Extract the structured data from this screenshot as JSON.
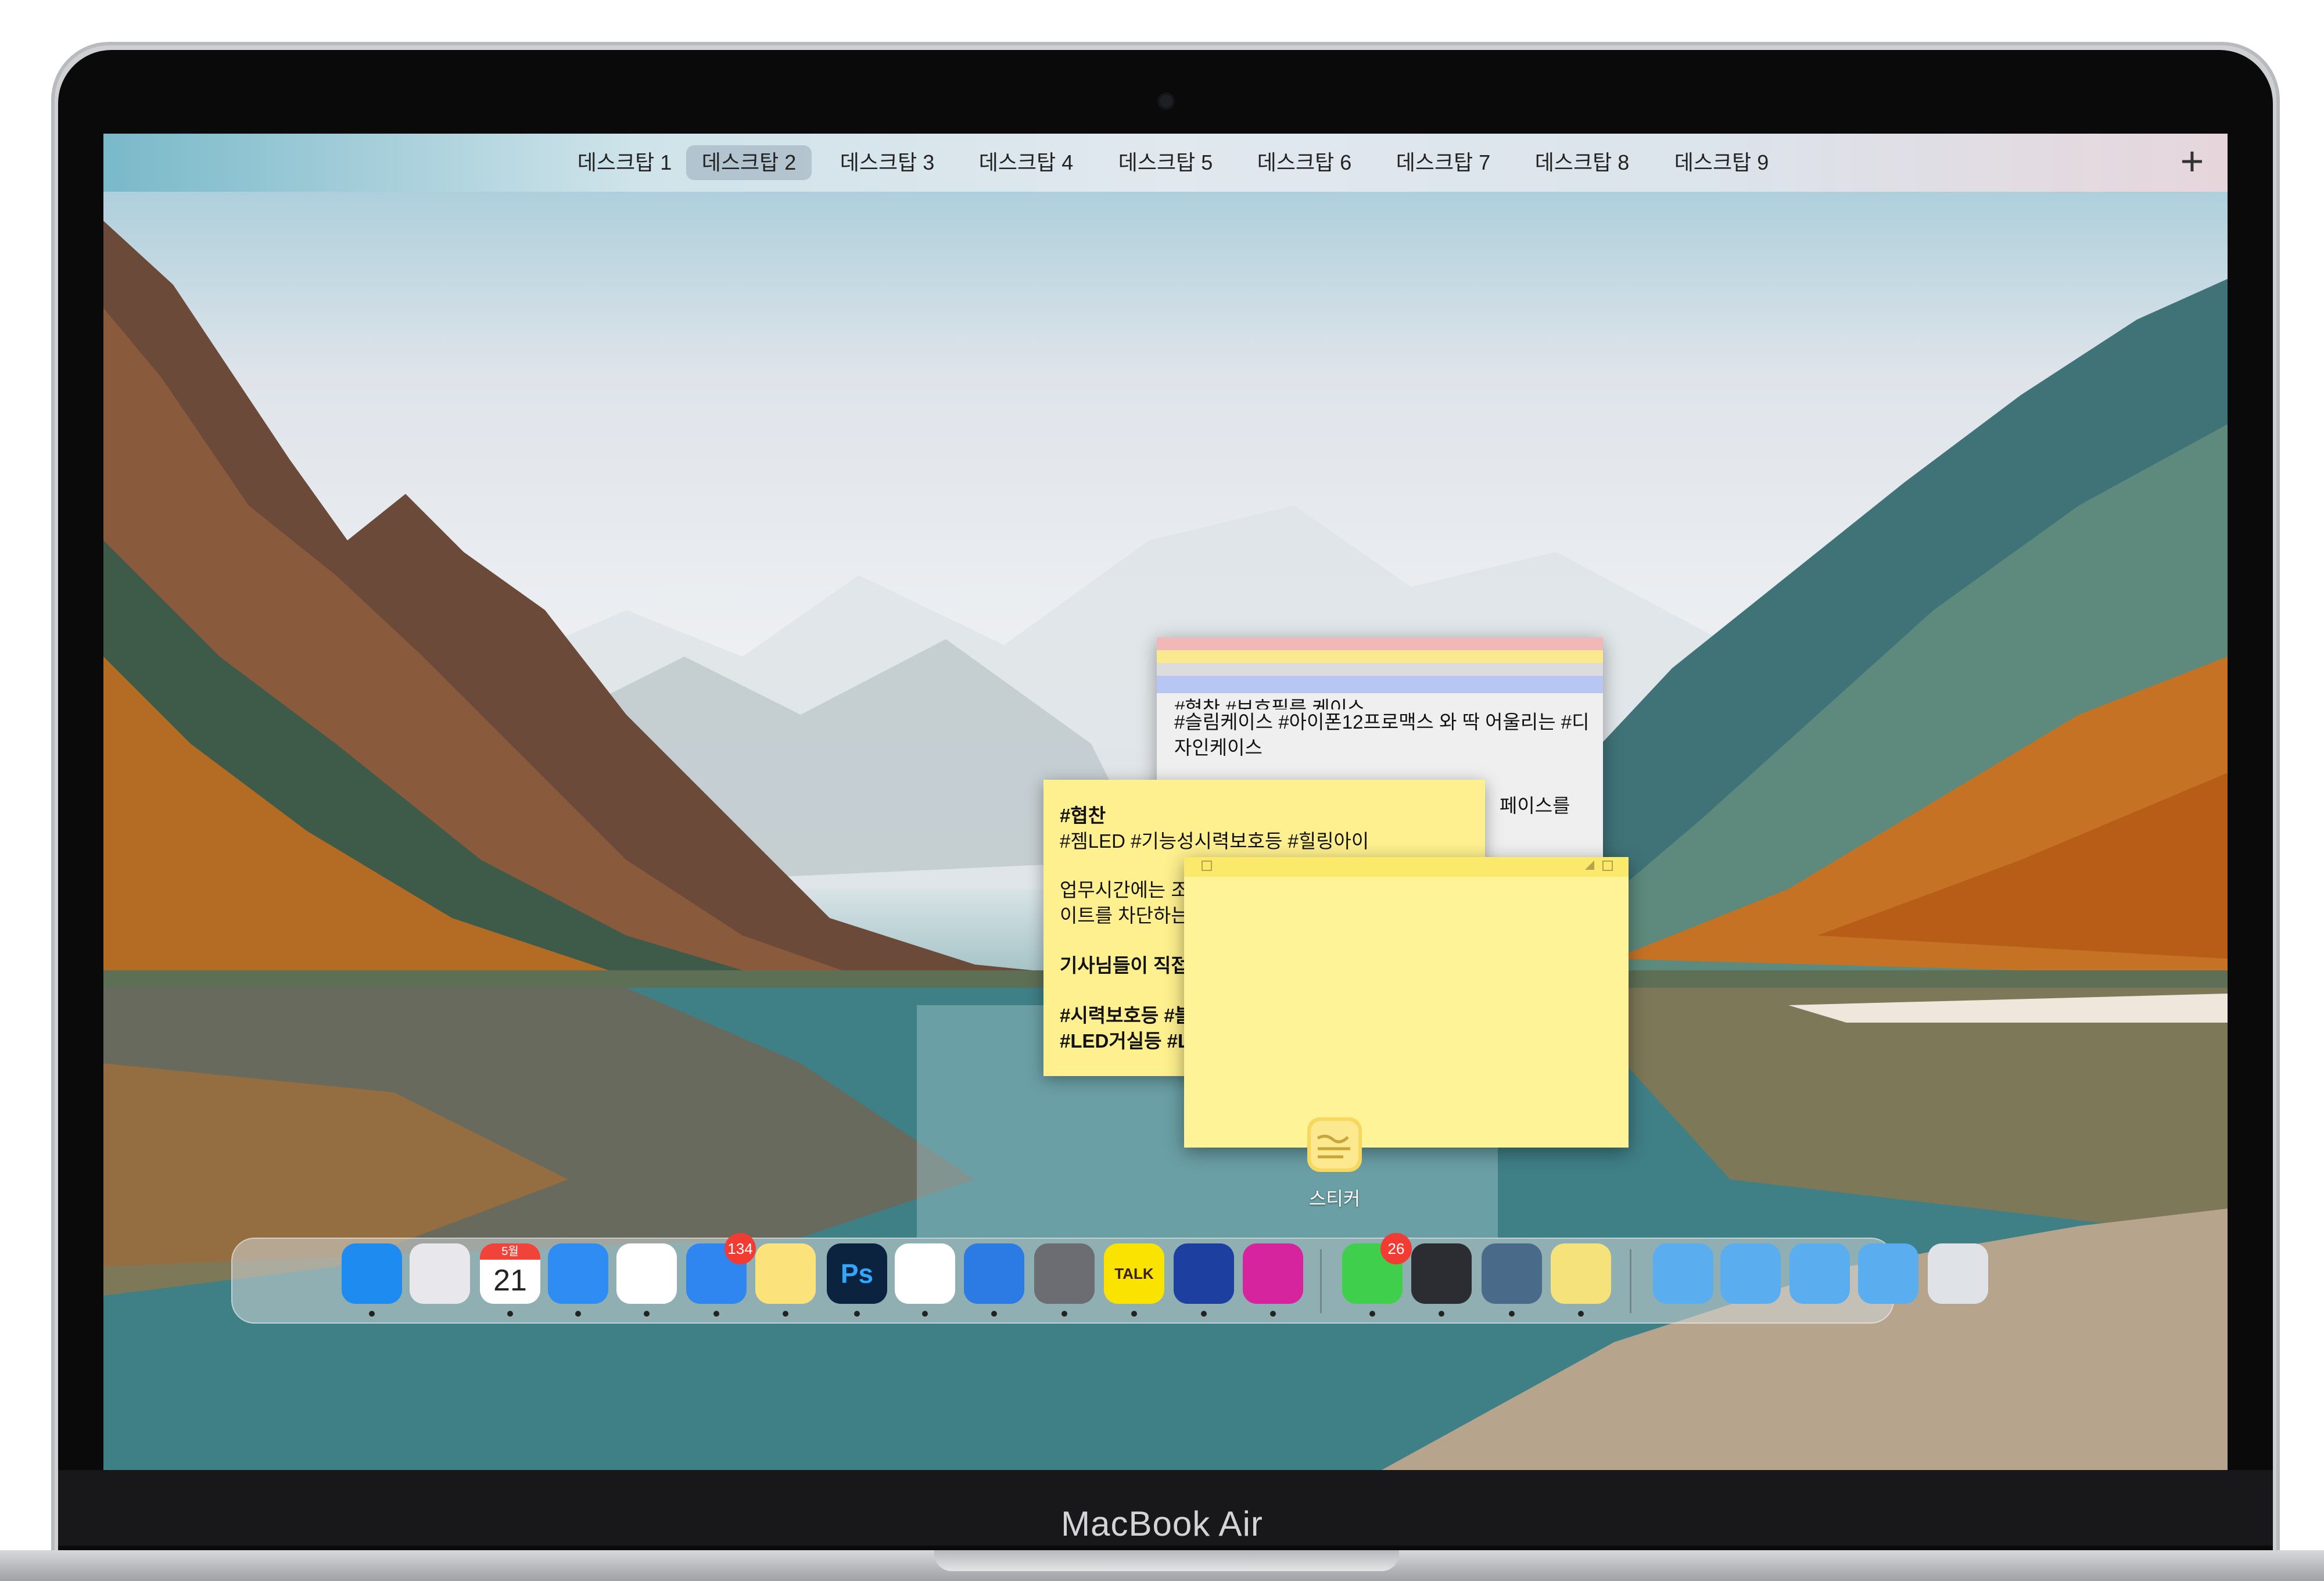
{
  "device": {
    "brand": "MacBook Air"
  },
  "spaces_bar": {
    "tabs": [
      "데스크탑 1",
      "데스크탑 2",
      "데스크탑 3",
      "데스크탑 4",
      "데스크탑 5",
      "데스크탑 6",
      "데스크탑 7",
      "데스크탑 8",
      "데스크탑 9"
    ],
    "active_index": 1,
    "add_label": "+"
  },
  "stickies": {
    "stack_note": {
      "line1": "#협찬 #보호필름 케이스",
      "line2": "#슬림케이스 #아이폰12프로맥스 와 딱 어울리는 #디",
      "line3": "자인케이스",
      "line4": "페이스를"
    },
    "middle_note": {
      "title": "#협찬",
      "tags": "#젬LED #기능성시력보호등 #힐링아이",
      "p1": "업무시간에는 조",
      "p2": "이트를 차단하는",
      "p3": "기사님들이 직접",
      "p4": "#시력보호등 #블",
      "p5": "#LED거실등 #L"
    },
    "app_label": "스티커"
  },
  "dock": {
    "items": [
      {
        "name": "finder-icon",
        "color": "#1e8bf0"
      },
      {
        "name": "launchpad-icon",
        "color": "#e8e8ec"
      },
      {
        "name": "calendar-icon",
        "color": "#ffffff",
        "month": "5월",
        "day": "21"
      },
      {
        "name": "safari-icon",
        "color": "#2f8cf2"
      },
      {
        "name": "photos-icon",
        "color": "#ffffff"
      },
      {
        "name": "mail-icon",
        "color": "#2f86f0",
        "badge": "134"
      },
      {
        "name": "notes-icon",
        "color": "#fbe27a"
      },
      {
        "name": "photoshop-icon",
        "color": "#0c2340",
        "text": "Ps"
      },
      {
        "name": "chrome-icon",
        "color": "#ffffff"
      },
      {
        "name": "keynote-icon",
        "color": "#2c7be5"
      },
      {
        "name": "system-preferences-icon",
        "color": "#6b6d72"
      },
      {
        "name": "kakaotalk-icon",
        "color": "#fbe300",
        "text": "TALK"
      },
      {
        "name": "tasks-icon",
        "color": "#1d3fa0"
      },
      {
        "name": "instagram-icon",
        "color": "#d6249f"
      },
      {
        "name": "messages-icon",
        "color": "#3fcf4d",
        "badge": "26"
      },
      {
        "name": "quicktime-icon",
        "color": "#2b2d33"
      },
      {
        "name": "preview-icon",
        "color": "#4a6a8a"
      },
      {
        "name": "stickies-icon",
        "color": "#f5e27a"
      },
      {
        "name": "folder-icon",
        "color": "#5aaef0"
      },
      {
        "name": "documents-folder-icon",
        "color": "#5aaef0"
      },
      {
        "name": "folder-icon",
        "color": "#5aaef0"
      },
      {
        "name": "downloads-folder-icon",
        "color": "#5aaef0"
      },
      {
        "name": "trash-icon",
        "color": "#dfe2e6"
      }
    ]
  }
}
